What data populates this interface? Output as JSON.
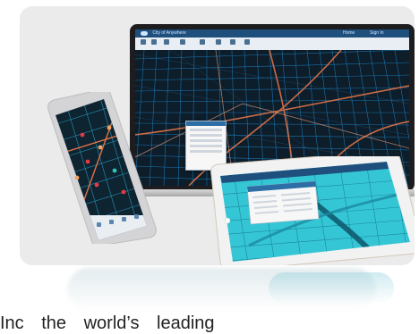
{
  "laptop_app": {
    "title": "City of Anywhere",
    "header_right_1": "Home",
    "header_right_2": "Sign In"
  },
  "caption": {
    "text": "Inc the world’s leading"
  },
  "colors": {
    "card_bg": "#ebebeb",
    "map_dark": "#0d1d2a",
    "parcel_blue": "#1f8fd6",
    "road_orange": "#e0744a",
    "tablet_cyan": "#35c6d6"
  }
}
